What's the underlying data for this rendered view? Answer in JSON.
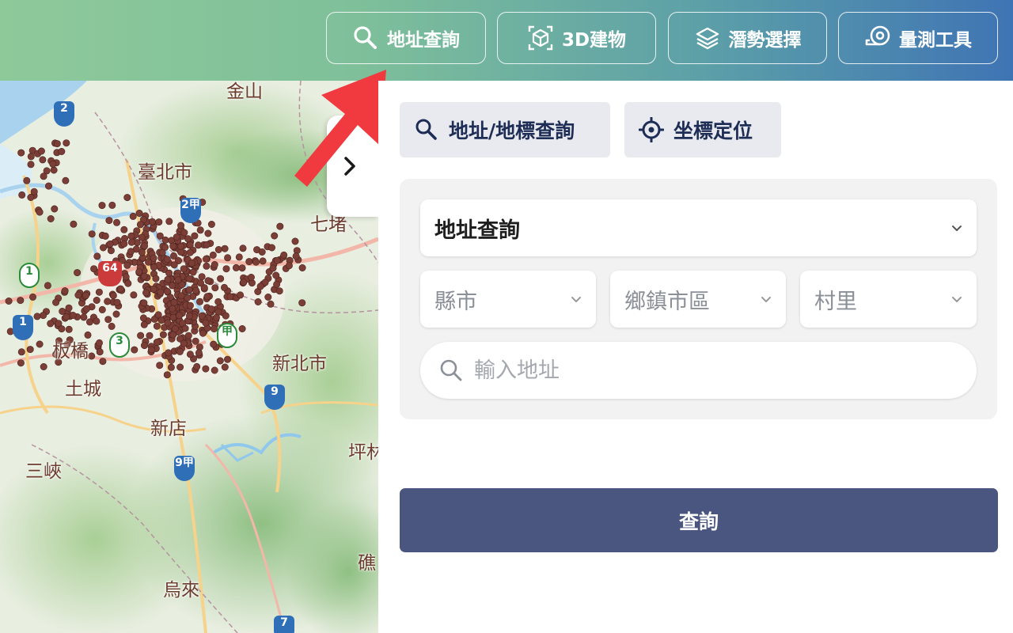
{
  "header": {
    "buttons": [
      {
        "label": "地址查詢",
        "icon": "search-icon"
      },
      {
        "label": "3D建物",
        "icon": "cube-icon"
      },
      {
        "label": "潛勢選擇",
        "icon": "layers-icon"
      },
      {
        "label": "量測工具",
        "icon": "measure-tape-icon"
      }
    ]
  },
  "map": {
    "labels": [
      "金山",
      "臺北市",
      "七堵",
      "新北市",
      "板橋",
      "土城",
      "新店",
      "三峽",
      "坪林",
      "烏來",
      "礁"
    ],
    "shields": [
      "2",
      "2甲",
      "64",
      "1",
      "1",
      "3",
      "9",
      "9甲",
      "7",
      "甲"
    ]
  },
  "panel": {
    "tabs": [
      {
        "label": "地址/地標查詢",
        "icon": "search-icon"
      },
      {
        "label": "坐標定位",
        "icon": "crosshair-icon"
      }
    ],
    "query_type": "地址查詢",
    "selects": [
      "縣市",
      "鄉鎮市區",
      "村里"
    ],
    "search_placeholder": "輸入地址",
    "submit_label": "查詢"
  },
  "colors": {
    "submit": "#4a5680",
    "tab_bg": "#e8eaef",
    "tab_text": "#1d2d55",
    "point": "#7a3e36",
    "arrow": "#f03a40"
  }
}
